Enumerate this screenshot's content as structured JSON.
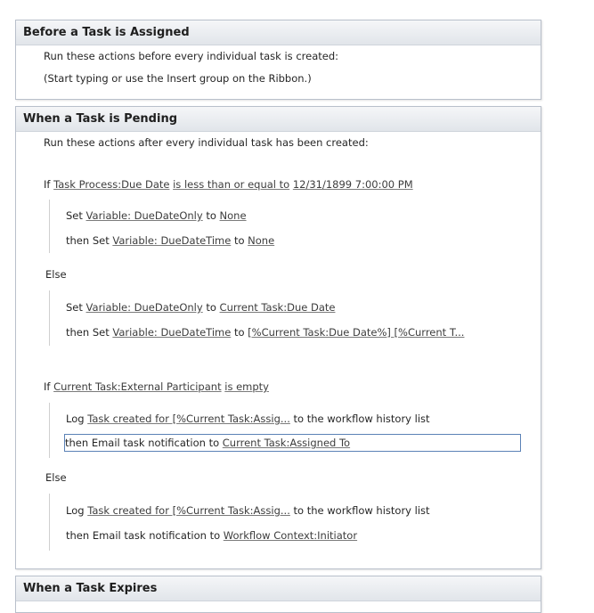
{
  "assigned": {
    "title": "Before a Task is Assigned",
    "intro": "Run these actions before every individual task is created:",
    "hint": "(Start typing or use the Insert group on the Ribbon.)"
  },
  "pending": {
    "title": "When a Task is Pending",
    "intro": "Run these actions after every individual task has been created:",
    "cond1": {
      "if": "If",
      "field": "Task Process:Due Date",
      "op": "is less than or equal to",
      "value": "12/31/1899 7:00:00 PM",
      "then": [
        {
          "prefix": "Set",
          "var": "Variable: DueDateOnly",
          "to": "to",
          "value": "None"
        },
        {
          "prefix": "then Set",
          "var": "Variable: DueDateTime",
          "to": "to",
          "value": "None"
        }
      ],
      "else_label": "Else",
      "else": [
        {
          "prefix": "Set",
          "var": "Variable: DueDateOnly",
          "to": "to",
          "value": "Current Task:Due Date"
        },
        {
          "prefix": "then Set",
          "var": "Variable: DueDateTime",
          "to": "to",
          "value": "[%Current Task:Due Date%] [%Current T..."
        }
      ]
    },
    "cond2": {
      "if": "If",
      "field": "Current Task:External Participant",
      "op": "is empty",
      "then": [
        {
          "prefix": "Log",
          "msg": "Task created for [%Current Task:Assig...",
          "suffix": "to the workflow history list"
        },
        {
          "prefix": "then Email task notification to",
          "recipient": "Current Task:Assigned To"
        }
      ],
      "else_label": "Else",
      "else": [
        {
          "prefix": "Log",
          "msg": "Task created for [%Current Task:Assig...",
          "suffix": "to the workflow history list"
        },
        {
          "prefix": "then Email task notification to",
          "recipient": "Workflow Context:Initiator"
        }
      ]
    }
  },
  "expires": {
    "title": "When a Task Expires"
  }
}
